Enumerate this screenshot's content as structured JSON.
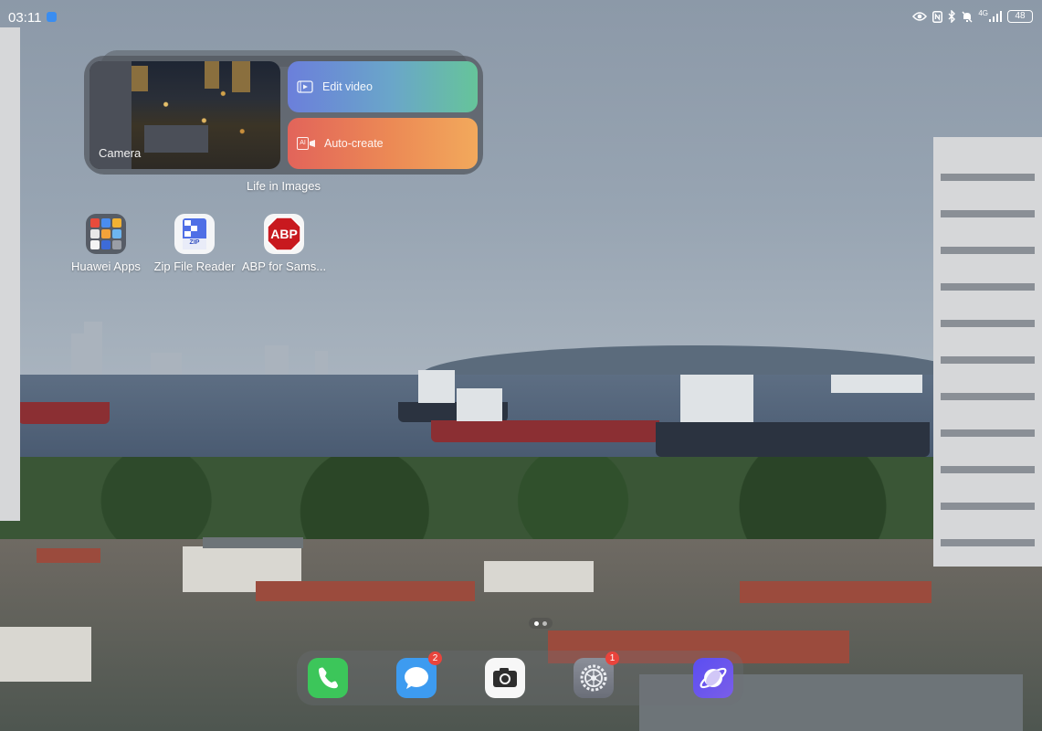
{
  "status_bar": {
    "time": "03:11",
    "battery_level": "48",
    "network_label": "4G"
  },
  "widget": {
    "camera_label": "Camera",
    "edit_video_label": "Edit video",
    "auto_create_label": "Auto-create",
    "auto_create_badge": "AI",
    "caption": "Life in Images"
  },
  "apps": [
    {
      "label": "Huawei Apps"
    },
    {
      "label": "Zip File Reader",
      "icon_text": "ZIP"
    },
    {
      "label": "ABP for Sams...",
      "icon_text": "ABP"
    }
  ],
  "dock": {
    "messages_badge": "2",
    "settings_badge": "1"
  },
  "colors": {
    "phone_green": "#3cc65a",
    "messages_blue": "#3d9bf0",
    "badge_red": "#e9443c",
    "browser_purple": "#6d5cf0",
    "abp_red": "#c8191f"
  }
}
